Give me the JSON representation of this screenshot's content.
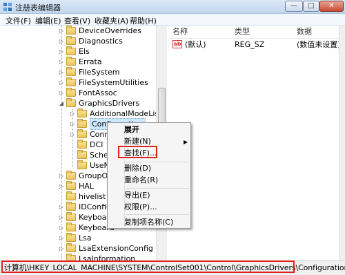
{
  "window": {
    "title": "注册表编辑器",
    "min_label": "—",
    "max_label": "□",
    "close_label": "✕"
  },
  "menu": [
    "文件(F)",
    "编辑(E)",
    "查看(V)",
    "收藏夹(A)",
    "帮助(H)"
  ],
  "tree": {
    "items": [
      {
        "label": "DeviceOverrides",
        "expanded": false
      },
      {
        "label": "Diagnostics",
        "expanded": false
      },
      {
        "label": "Els",
        "expanded": false
      },
      {
        "label": "Errata",
        "expanded": false
      },
      {
        "label": "FileSystem",
        "expanded": false
      },
      {
        "label": "FileSystemUtilities",
        "expanded": false
      },
      {
        "label": "FontAssoc",
        "expanded": false
      },
      {
        "label": "GraphicsDrivers",
        "expanded": true
      },
      {
        "label": "AdditionalModeLists",
        "expanded": false
      },
      {
        "label": "Configuration",
        "expanded": false,
        "selected": true
      },
      {
        "label": "Conne",
        "expanded": false
      },
      {
        "label": "DCI",
        "expanded": false
      },
      {
        "label": "Schedu",
        "expanded": false
      },
      {
        "label": "UseNev",
        "expanded": false
      },
      {
        "label": "GroupOrd",
        "expanded": false
      },
      {
        "label": "HAL",
        "expanded": false
      },
      {
        "label": "hivelist",
        "expanded": false
      },
      {
        "label": "IDConfigD",
        "expanded": false
      },
      {
        "label": "Keyboard",
        "expanded": false
      },
      {
        "label": "Keyboard",
        "expanded": false
      },
      {
        "label": "Lsa",
        "expanded": false
      },
      {
        "label": "LsaExtensionConfig",
        "expanded": false
      },
      {
        "label": "LsaInformation",
        "expanded": false
      }
    ]
  },
  "list": {
    "columns": [
      "名称",
      "类型",
      "数据"
    ],
    "rows": [
      {
        "icon": "ab",
        "name": "(默认)",
        "type": "REG_SZ",
        "data": "(数值未设置)"
      }
    ]
  },
  "context_menu": {
    "items": [
      "展开",
      "新建(N)",
      "查找(F)...",
      "删除(D)",
      "重命名(R)",
      "导出(E)",
      "权限(P)...",
      "复制项名称(C)"
    ],
    "submenu_arrow": "▶"
  },
  "status": "计算机\\HKEY_LOCAL_MACHINE\\SYSTEM\\ControlSet001\\Control\\GraphicsDrivers\\Configuration",
  "colors": {
    "highlight_box": "#e0201d",
    "selection": "#cde8ff",
    "folder": "#e9c45a"
  }
}
